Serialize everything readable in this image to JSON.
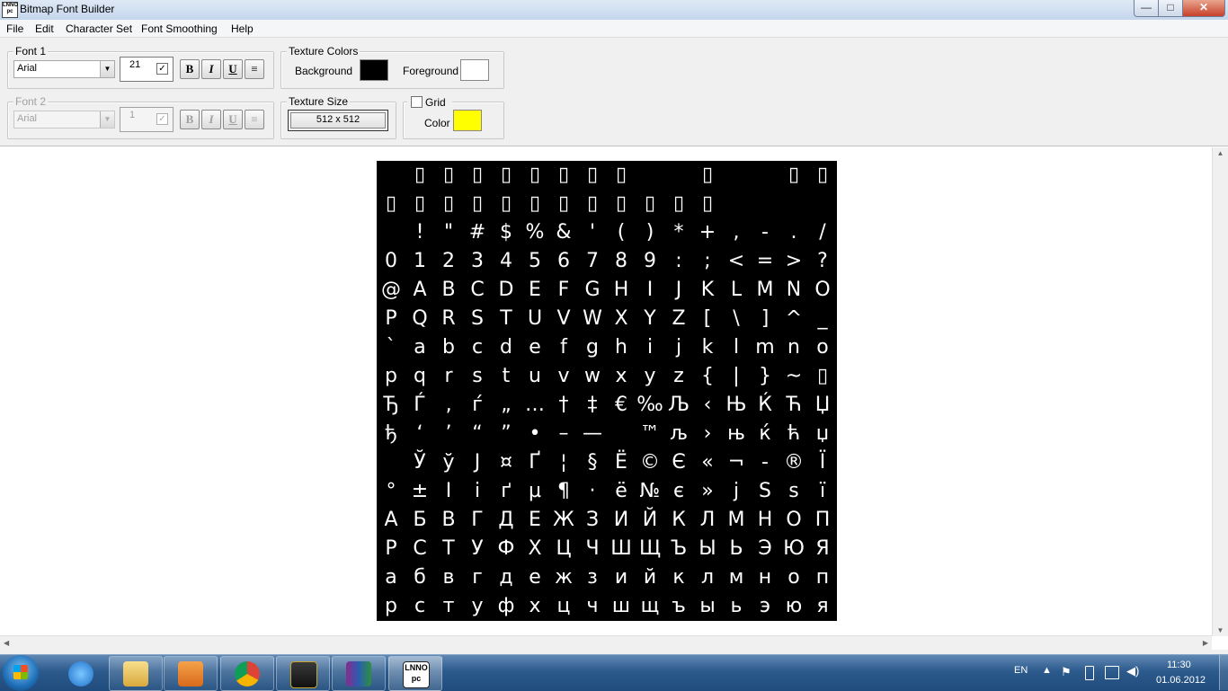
{
  "window": {
    "title": "Bitmap Font Builder",
    "icon_text_top": "LNNO",
    "icon_text_bottom": "pc",
    "min_symbol": "—",
    "max_symbol": "□",
    "close_symbol": "✕"
  },
  "menu": [
    "File",
    "Edit",
    "Character Set",
    "Font Smoothing",
    "Help"
  ],
  "font1": {
    "title": "Font 1",
    "font": "Arial",
    "size": "21",
    "checked": true,
    "bold": "B",
    "italic": "I",
    "underline": "U",
    "align": "≡"
  },
  "font2": {
    "title": "Font 2",
    "font": "Arial",
    "size": "1",
    "checked": true,
    "bold": "B",
    "italic": "I",
    "underline": "U",
    "align": "≡"
  },
  "texture_colors": {
    "title": "Texture Colors",
    "background_label": "Background",
    "background_color": "#000000",
    "foreground_label": "Foreground",
    "foreground_color": "#ffffff"
  },
  "texture_size": {
    "title": "Texture Size",
    "value": "512 x 512"
  },
  "grid": {
    "label": "Grid",
    "checked": false,
    "color_label": "Color",
    "color": "#ffff00"
  },
  "glyph_rows": [
    [
      "",
      "▯",
      "▯",
      "▯",
      "▯",
      "▯",
      "▯",
      "▯",
      "▯",
      "",
      "",
      "▯",
      "",
      "",
      "▯",
      "▯"
    ],
    [
      "▯",
      "▯",
      "▯",
      "▯",
      "▯",
      "▯",
      "▯",
      "▯",
      "▯",
      "▯",
      "▯",
      "▯",
      "",
      "",
      "",
      ""
    ],
    [
      "",
      "!",
      "\"",
      "#",
      "$",
      "%",
      "&",
      "'",
      "(",
      ")",
      "*",
      "+",
      ",",
      "-",
      ".",
      "/"
    ],
    [
      "0",
      "1",
      "2",
      "3",
      "4",
      "5",
      "6",
      "7",
      "8",
      "9",
      ":",
      ";",
      "<",
      "=",
      ">",
      "?"
    ],
    [
      "@",
      "A",
      "B",
      "C",
      "D",
      "E",
      "F",
      "G",
      "H",
      "I",
      "J",
      "K",
      "L",
      "M",
      "N",
      "O"
    ],
    [
      "P",
      "Q",
      "R",
      "S",
      "T",
      "U",
      "V",
      "W",
      "X",
      "Y",
      "Z",
      "[",
      "\\",
      "]",
      "^",
      "_"
    ],
    [
      "`",
      "a",
      "b",
      "c",
      "d",
      "e",
      "f",
      "g",
      "h",
      "i",
      "j",
      "k",
      "l",
      "m",
      "n",
      "o"
    ],
    [
      "p",
      "q",
      "r",
      "s",
      "t",
      "u",
      "v",
      "w",
      "x",
      "y",
      "z",
      "{",
      "|",
      "}",
      "~",
      "▯"
    ],
    [
      "Ђ",
      "Ѓ",
      "‚",
      "ѓ",
      "„",
      "…",
      "†",
      "‡",
      "€",
      "‰",
      "Љ",
      "‹",
      "Њ",
      "Ќ",
      "Ћ",
      "Џ"
    ],
    [
      "ђ",
      "‘",
      "’",
      "“",
      "”",
      "•",
      "–",
      "—",
      "",
      "™",
      "љ",
      "›",
      "њ",
      "ќ",
      "ћ",
      "џ"
    ],
    [
      "",
      "Ў",
      "ў",
      "Ј",
      "¤",
      "Ґ",
      "¦",
      "§",
      "Ё",
      "©",
      "Є",
      "«",
      "¬",
      "-",
      "®",
      "Ї"
    ],
    [
      "°",
      "±",
      "І",
      "і",
      "ґ",
      "µ",
      "¶",
      "·",
      "ё",
      "№",
      "є",
      "»",
      "ј",
      "Ѕ",
      "ѕ",
      "ї"
    ],
    [
      "А",
      "Б",
      "В",
      "Г",
      "Д",
      "Е",
      "Ж",
      "З",
      "И",
      "Й",
      "К",
      "Л",
      "М",
      "Н",
      "О",
      "П"
    ],
    [
      "Р",
      "С",
      "Т",
      "У",
      "Ф",
      "Х",
      "Ц",
      "Ч",
      "Ш",
      "Щ",
      "Ъ",
      "Ы",
      "Ь",
      "Э",
      "Ю",
      "Я"
    ],
    [
      "а",
      "б",
      "в",
      "г",
      "д",
      "е",
      "ж",
      "з",
      "и",
      "й",
      "к",
      "л",
      "м",
      "н",
      "о",
      "п"
    ],
    [
      "р",
      "с",
      "т",
      "у",
      "ф",
      "х",
      "ц",
      "ч",
      "ш",
      "щ",
      "ъ",
      "ы",
      "ь",
      "э",
      "ю",
      "я"
    ]
  ],
  "taskbar": {
    "language": "EN",
    "time": "11:30",
    "date": "01.06.2012",
    "pinned": [
      "internet-explorer-icon",
      "explorer-folder-icon",
      "media-player-icon",
      "chrome-icon",
      "game-icon",
      "winrar-icon",
      "bitmap-font-builder-icon"
    ],
    "active_app_text_top": "LNNO",
    "active_app_text_bottom": "pc"
  }
}
